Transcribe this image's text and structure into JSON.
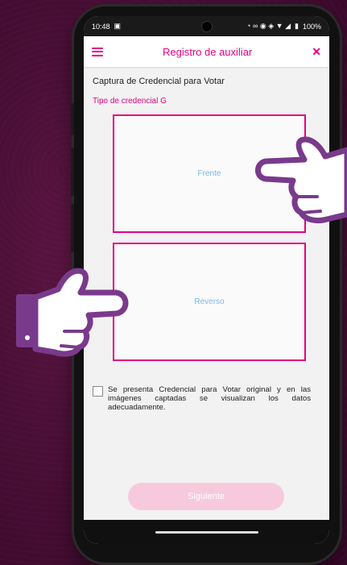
{
  "status_bar": {
    "time": "10:48",
    "battery": "100%"
  },
  "app_bar": {
    "title": "Registro de auxiliar"
  },
  "content": {
    "section_title": "Captura de Credencial para Votar",
    "credential_type": "Tipo de credencial G",
    "front_label": "Frente",
    "back_label": "Reverso",
    "confirm_text": "Se presenta Credencial para Votar original y en las imágenes captadas se visualizan los datos adecuadamente.",
    "confirm_checked": false,
    "next_button": "Siguiente"
  },
  "colors": {
    "accent": "#e6007e",
    "background": "#4e1038",
    "button_disabled": "#f7c9dc",
    "placeholder": "#7ab8ee"
  },
  "icons": [
    "menu-icon",
    "close-icon",
    "camera-icon",
    "battery-icon",
    "pointing-hand-icon"
  ]
}
